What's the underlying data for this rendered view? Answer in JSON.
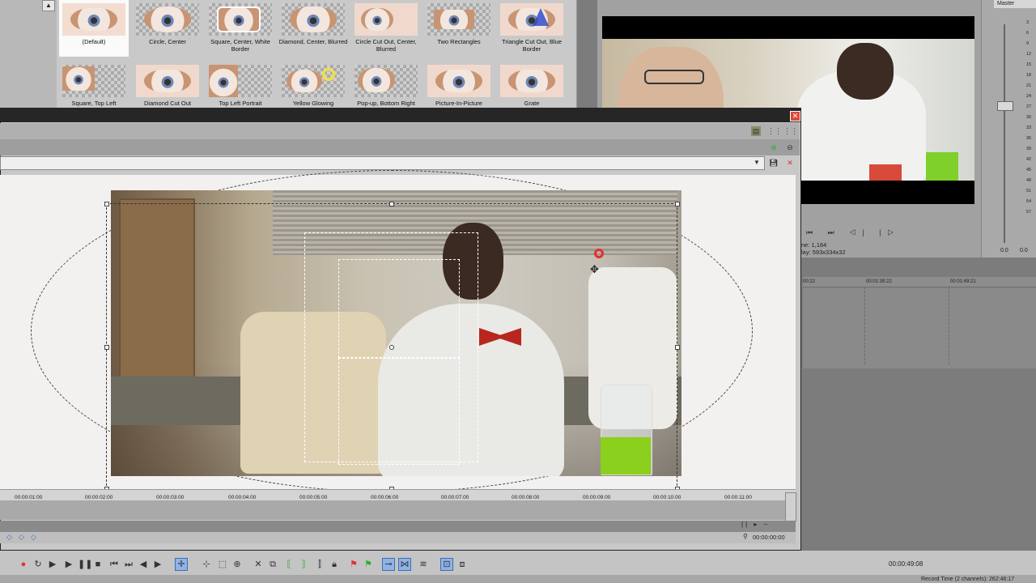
{
  "presets": {
    "items": [
      {
        "label": "(Default)"
      },
      {
        "label": "Circle, Center"
      },
      {
        "label": "Square, Center, White Border"
      },
      {
        "label": "Diamond, Center, Blurred"
      },
      {
        "label": "Circle Cut Out, Center, Blurred"
      },
      {
        "label": "Two Rectangles"
      },
      {
        "label": "Triangle Cut Out, Blue Border"
      },
      {
        "label": "Square, Top Left"
      },
      {
        "label": "Diamond Cut Out"
      },
      {
        "label": "Top Left Portrait"
      },
      {
        "label": "Yellow Glowing"
      },
      {
        "label": "Pop-up, Bottom Right"
      },
      {
        "label": "Picture-In-Picture"
      },
      {
        "label": "Grate"
      }
    ],
    "scroll_up": "▲"
  },
  "audio": {
    "tab_label": "Master",
    "meter_ticks": [
      "3",
      "6",
      "9",
      "12",
      "15",
      "18",
      "21",
      "24",
      "27",
      "30",
      "33",
      "36",
      "39",
      "42",
      "45",
      "48",
      "51",
      "54",
      "57"
    ],
    "bottom_value": "0.0",
    "bottom_value2": "0.0"
  },
  "preview": {
    "controls": "⏮ ⏭ ◁| |▷",
    "info_line1": "ne:  1,184",
    "info_line2": "lay:  593x334x32"
  },
  "timeline": {
    "ruler_labels": [
      "00:22",
      "00:01:39:22",
      "00:01:49:21"
    ]
  },
  "crop": {
    "close_label": "✕",
    "ruler_labels": [
      "00:00:01:00",
      "00:00:02:00",
      "00:00:03:00",
      "00:00:04:00",
      "00:00:05:00",
      "00:00:06:00",
      "00:00:07:00",
      "00:00:08:00",
      "00:00:09:00",
      "00:00:10:00",
      "00:00:11:00"
    ],
    "cursor_time": "00:00:00:00",
    "keyframe_icons": "◇◇◇",
    "scroll_ctrls": "|| ▸ −"
  },
  "main": {
    "transport_time": "00:00:49:08",
    "record_time": "Record Time (2 channels): 262:46:17"
  }
}
